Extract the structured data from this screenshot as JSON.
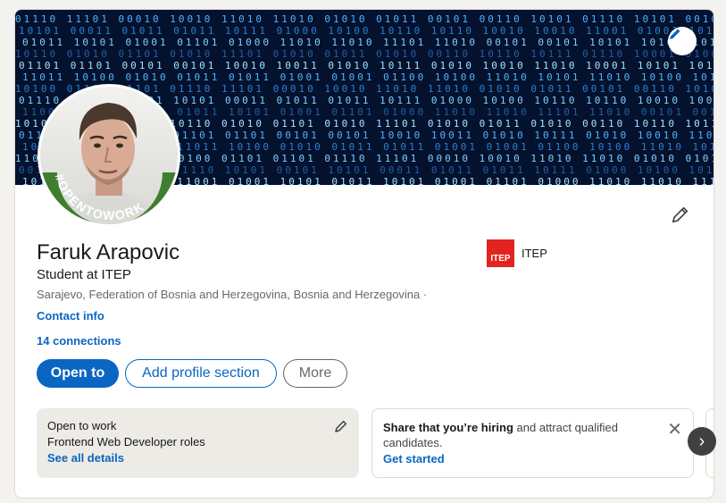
{
  "profile": {
    "name": "Faruk Arapovic",
    "headline": "Student at ITEP",
    "location": "Sarajevo, Federation of Bosnia and Herzegovina, Bosnia and Herzegovina ·",
    "contact_info": "Contact info",
    "connections": "14 connections",
    "frame_badge": "#OPENTOWORK"
  },
  "banner": {
    "binary_text": "011 1011 10 100010 10 0101 101 0110 10 01010 0101 10010 1001 1010 101 01 1101 010 1001 0110 10100 0110 1011 01"
  },
  "company": {
    "logo_text": "ITEP",
    "name": "ITEP"
  },
  "actions": {
    "open_to": "Open to",
    "add_section": "Add profile section",
    "more": "More"
  },
  "open_to_work": {
    "title": "Open to work",
    "roles": "Frontend Web Developer roles",
    "link": "See all details"
  },
  "hiring": {
    "bold_text": "Share that you’re hiring",
    "rest_text": " and attract qualified candidates.",
    "link": "Get started",
    "close": "✕"
  },
  "carousel": {
    "next": "›"
  },
  "colors": {
    "primary": "#0a66c2",
    "otw_green": "#3f7e2f",
    "company_red": "#e3231f",
    "banner_bg": "#04122e"
  }
}
